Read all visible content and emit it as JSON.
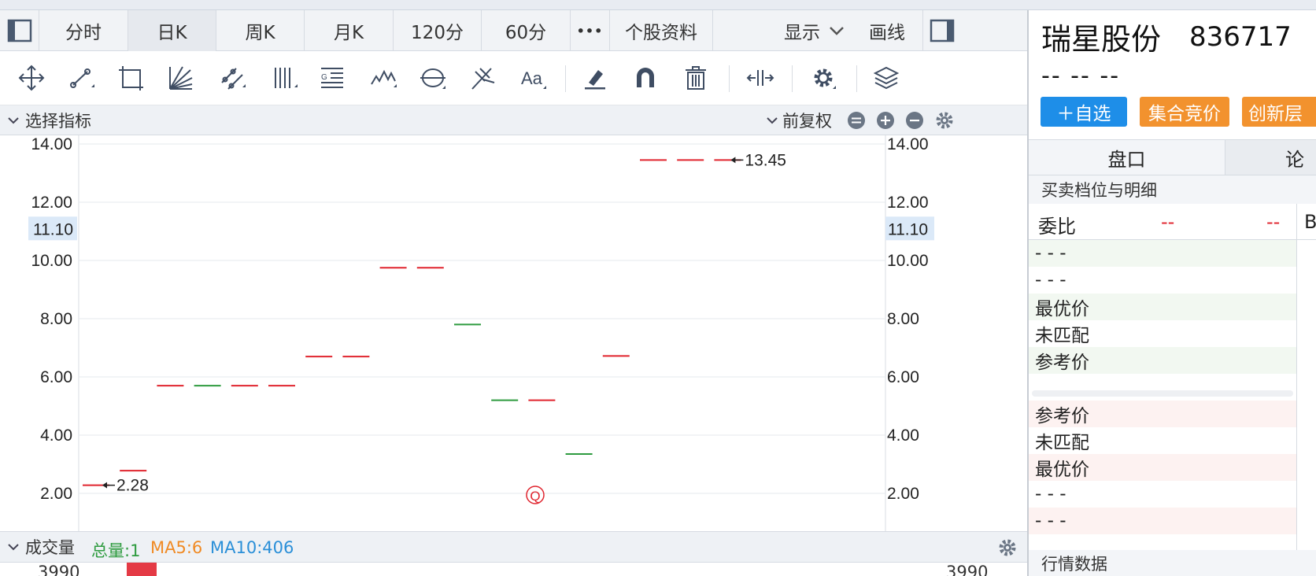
{
  "period_bar": {
    "items": [
      "分时",
      "日K",
      "周K",
      "月K",
      "120分",
      "60分",
      "•••",
      "个股资料"
    ],
    "active": "日K",
    "display_label": "显示",
    "draw_label": "画线"
  },
  "tools": [
    "move-icon",
    "line-segment-icon",
    "rectangle-icon",
    "fan-lines-icon",
    "parallel-channel-icon",
    "vertical-lines-icon",
    "gann-text-icon",
    "wave-icon",
    "cycle-icon",
    "fork-icon",
    "text-icon",
    "eraser-icon",
    "magnet-icon",
    "trash-icon",
    "width-adjust-icon",
    "settings-icon",
    "layers-icon"
  ],
  "indicator_bar": {
    "select_label": "选择指标",
    "adjust_label": "前复权"
  },
  "volume_bar": {
    "label": "成交量",
    "total": "总量:1",
    "ma5": "MA5:6",
    "ma10": "MA10:406",
    "axis_top_label": "3990"
  },
  "chart_data": {
    "type": "candlestick",
    "y_ticks": [
      "14.00",
      "12.00",
      "10.00",
      "8.00",
      "6.00",
      "4.00",
      "2.00"
    ],
    "ylim": [
      1.6,
      14.2
    ],
    "crosshair_label": "11.10",
    "crosshair_value": 11.1,
    "max_label": "13.45",
    "min_label": "2.28",
    "marker_label": "Q",
    "candles": [
      {
        "value": 2.28,
        "dir": "up"
      },
      {
        "value": 2.78,
        "dir": "up"
      },
      {
        "value": 5.7,
        "dir": "up"
      },
      {
        "value": 5.7,
        "dir": "down"
      },
      {
        "value": 5.7,
        "dir": "up"
      },
      {
        "value": 5.7,
        "dir": "up"
      },
      {
        "value": 6.7,
        "dir": "up"
      },
      {
        "value": 6.7,
        "dir": "up"
      },
      {
        "value": 9.75,
        "dir": "up"
      },
      {
        "value": 9.75,
        "dir": "up"
      },
      {
        "value": 7.8,
        "dir": "down"
      },
      {
        "value": 5.2,
        "dir": "down"
      },
      {
        "value": 5.2,
        "dir": "up"
      },
      {
        "value": 3.35,
        "dir": "down"
      },
      {
        "value": 6.72,
        "dir": "up"
      },
      {
        "value": 13.45,
        "dir": "up"
      },
      {
        "value": 13.45,
        "dir": "up"
      },
      {
        "value": 13.45,
        "dir": "up"
      }
    ],
    "colors": {
      "up": "#e0242e",
      "down": "#2e9b3f"
    }
  },
  "stock": {
    "name": "瑞星股份",
    "code": "836717",
    "price_line": "-- -- --"
  },
  "buttons": {
    "watchlist": "＋自选",
    "auction": "集合竞价",
    "innovation": "创新层"
  },
  "tabs": [
    "盘口",
    "论"
  ],
  "orderbook": {
    "title": "买卖档位与明细",
    "ratio_label": "委比",
    "ratio_val1": "--",
    "ratio_val2": "--",
    "ratio_side": "B",
    "sell_rows": [
      "- - -",
      "- - -",
      "最优价",
      "未匹配",
      "参考价"
    ],
    "buy_rows": [
      "参考价",
      "未匹配",
      "最优价",
      "- - -",
      "- - -"
    ]
  },
  "footer": {
    "title": "行情数据"
  }
}
